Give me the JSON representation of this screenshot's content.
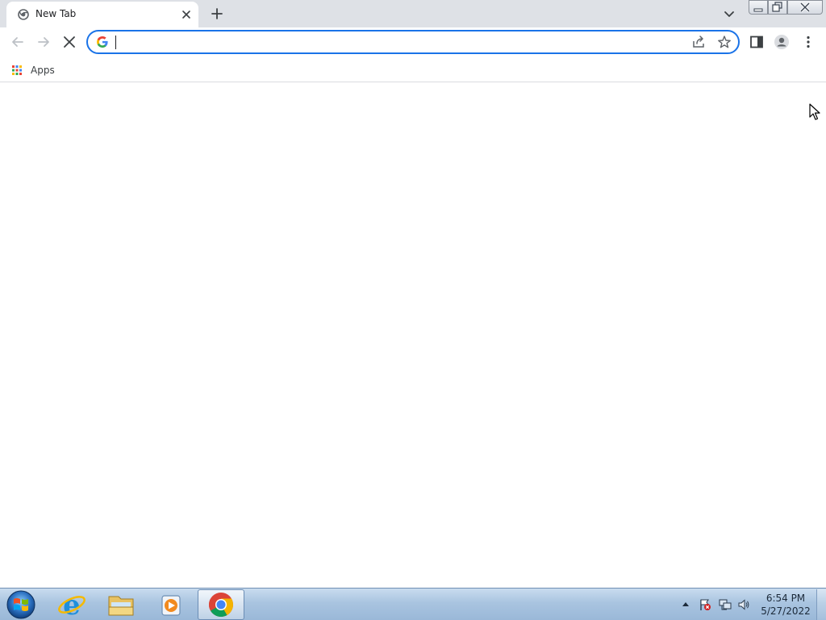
{
  "browser": {
    "tab": {
      "title": "New Tab",
      "favicon": "chrome-newtab-icon",
      "close_icon": "close-icon"
    },
    "new_tab_icon": "plus-icon",
    "tab_search_icon": "chevron-down-icon",
    "window_controls": {
      "minimize": "minimize-icon",
      "maximize": "restore-icon",
      "close": "close-icon"
    }
  },
  "toolbar": {
    "back_icon": "back-arrow-icon",
    "forward_icon": "forward-arrow-icon",
    "stop_icon": "stop-loading-icon",
    "omnibox": {
      "value": "",
      "placeholder": "",
      "provider_icon": "google-g-icon",
      "share_icon": "share-icon",
      "bookmark_icon": "star-icon"
    },
    "side_panel_icon": "side-panel-icon",
    "profile_icon": "profile-icon",
    "menu_icon": "kebab-menu-icon"
  },
  "bookmarks_bar": {
    "apps_label": "Apps",
    "apps_icon": "apps-grid-icon"
  },
  "taskbar": {
    "start_icon": "windows-start-icon",
    "pinned": [
      {
        "name": "internet-explorer",
        "icon": "ie-icon"
      },
      {
        "name": "file-explorer",
        "icon": "folder-icon"
      },
      {
        "name": "media-player",
        "icon": "media-player-icon"
      },
      {
        "name": "google-chrome",
        "icon": "chrome-icon",
        "active": true
      }
    ],
    "tray": [
      "show-hidden-icons",
      "action-center-flag-icon",
      "network-icon",
      "volume-icon"
    ],
    "clock": {
      "time": "6:54 PM",
      "date": "5/27/2022"
    }
  },
  "colors": {
    "accent": "#1a73e8",
    "tabstrip": "#dee1e6",
    "taskbar": "#a9c4e0"
  }
}
